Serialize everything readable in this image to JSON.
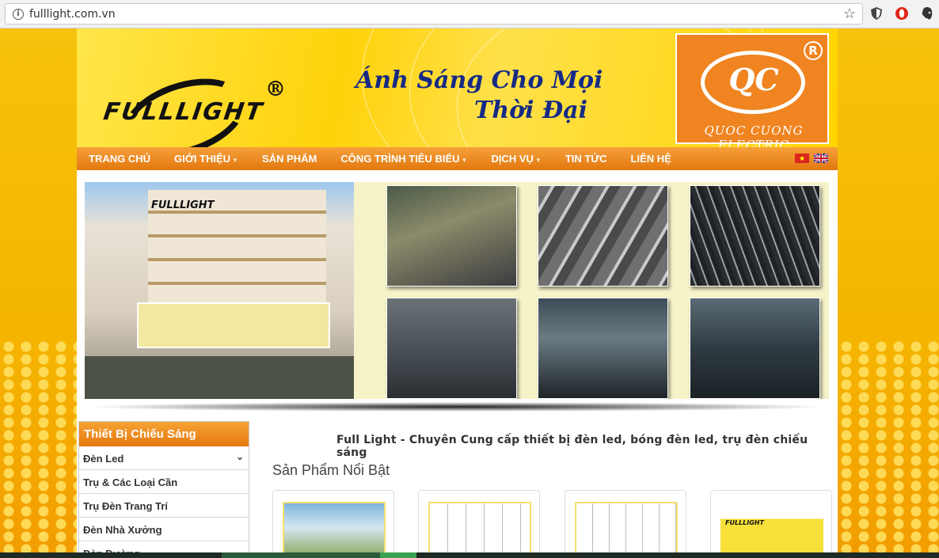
{
  "browser": {
    "url": "fulllight.com.vn"
  },
  "banner": {
    "logo_text": "FULLLIGHT",
    "registered_mark": "®",
    "slogan_line1": "Ánh Sáng Cho Mọi",
    "slogan_line2": "Thời Đại",
    "qc_logo_text": "QC",
    "qc_registered": "R",
    "qc_company": "QUOC CUONG ELECTRIC"
  },
  "nav": {
    "items": [
      {
        "label": "TRANG CHỦ",
        "dropdown": false
      },
      {
        "label": "GIỚI THIỆU",
        "dropdown": true
      },
      {
        "label": "SẢN PHẨM",
        "dropdown": false
      },
      {
        "label": "CÔNG TRÌNH TIÊU BIỂU",
        "dropdown": true
      },
      {
        "label": "DỊCH VỤ",
        "dropdown": true
      },
      {
        "label": "TIN TỨC",
        "dropdown": false
      },
      {
        "label": "LIÊN HỆ",
        "dropdown": false
      }
    ]
  },
  "slider": {
    "signboard_text": "FULLLIGHT"
  },
  "sidebar": {
    "title": "Thiết Bị Chiếu Sáng",
    "items": [
      {
        "label": "Đèn Led"
      },
      {
        "label": "Trụ & Các Loại Cần"
      },
      {
        "label": "Trụ Đèn Trang Trí"
      },
      {
        "label": "Đèn Nhà Xưởng"
      },
      {
        "label": "Đèn Đường"
      }
    ]
  },
  "main": {
    "tagline": "Full Light - Chuyên Cung cấp thiết bị đèn led, bóng đèn led, trụ đèn chiếu sáng",
    "section_title": "Sản Phẩm Nổi Bật",
    "card4_logo": "FULLLIGHT"
  },
  "colors": {
    "nav_orange": "#e2780f",
    "banner_yellow": "#ffd20a",
    "slogan_blue": "#162a85",
    "qc_orange": "#f08420"
  }
}
